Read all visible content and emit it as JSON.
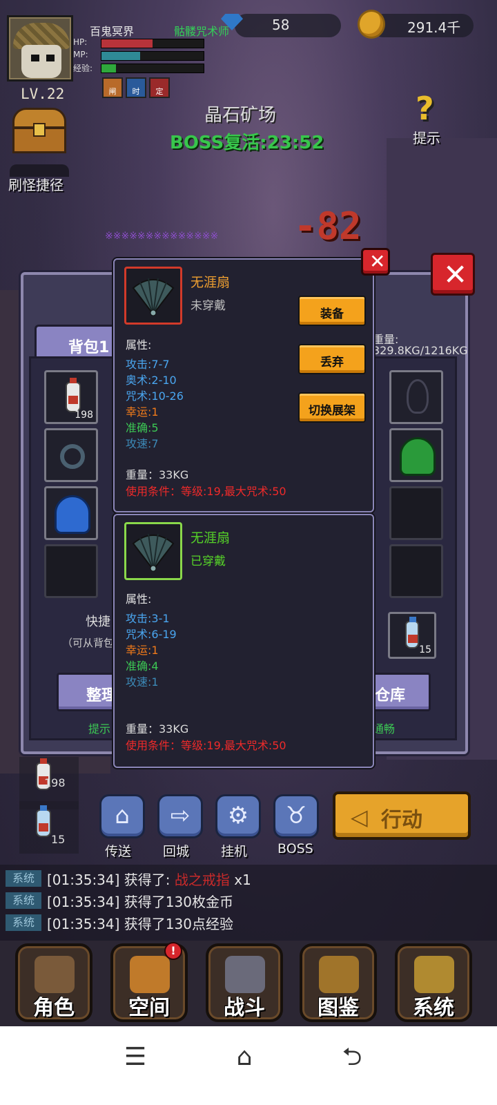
{
  "header": {
    "player_name": "百鬼冥界",
    "player_class": "骷髅咒术师",
    "stats": {
      "hp_label": "HP:",
      "hp_fraction": 0.5,
      "mp_label": "MP:",
      "mp_fraction": 0.38,
      "exp_label": "经验:",
      "exp_fraction": 0.14
    },
    "level": "LV.22",
    "buffs": [
      "闸",
      "时",
      "定"
    ],
    "gems": "58",
    "gold": "291.4千",
    "chest_shortcut_label": "刷怪捷径",
    "hint_label": "提示"
  },
  "map": {
    "name": "晶石矿场",
    "boss_timer": "BOSS复活:23:52"
  },
  "combat": {
    "damage": "-82",
    "scroll_text": "※※※※※※※※※※※※※※"
  },
  "bag": {
    "tab_label": "背包1",
    "weight_label": "重量:",
    "weight_value": "329.8KG/1216KG",
    "slot_counts": {
      "potion_red": "198",
      "potion_blue": "15"
    },
    "shortcut_title": "快捷",
    "shortcut_sub": "（可从背包",
    "btn_sort": "整理",
    "btn_storage": "仓库",
    "tip_left": "提示",
    "tip_right": "通畅"
  },
  "item_new": {
    "name": "无涯扇",
    "state": "未穿戴",
    "attr_title": "属性:",
    "attrs": [
      {
        "text": "攻击:7-7",
        "color": "#4aa6f0"
      },
      {
        "text": "奥术:2-10",
        "color": "#4aa6f0"
      },
      {
        "text": "咒术:10-26",
        "color": "#4aa6f0"
      },
      {
        "text": "幸运:1",
        "color": "#f07a1a"
      },
      {
        "text": "准确:5",
        "color": "#3cc854"
      },
      {
        "text": "攻速:7",
        "color": "#3c8ab8"
      }
    ],
    "weight": "重量：33KG",
    "requirement": "使用条件：等级:19,最大咒术:50",
    "buttons": {
      "equip": "装备",
      "discard": "丢弃",
      "switch_rack": "切换展架"
    }
  },
  "item_equipped": {
    "name": "无涯扇",
    "state": "已穿戴",
    "attr_title": "属性:",
    "attrs": [
      {
        "text": "攻击:3-1",
        "color": "#4aa6f0"
      },
      {
        "text": "咒术:6-19",
        "color": "#4aa6f0"
      },
      {
        "text": "幸运:1",
        "color": "#f07a1a"
      },
      {
        "text": "准确:4",
        "color": "#3cc854"
      },
      {
        "text": "攻速:1",
        "color": "#3c8ab8"
      }
    ],
    "weight": "重量：33KG",
    "requirement": "使用条件：等级:19,最大咒术:50"
  },
  "quick": {
    "red_count": "198",
    "blue_count": "15"
  },
  "actions": {
    "teleport": "传送",
    "return_city": "回城",
    "idle": "挂机",
    "boss": "BOSS",
    "go": "行动"
  },
  "log": {
    "tag": "系统",
    "rows": [
      {
        "time": "[01:35:34]",
        "prefix": "获得了:",
        "item": "战之戒指",
        "suffix": "x1"
      },
      {
        "time": "[01:35:34]",
        "prefix": "获得了130枚金币",
        "item": "",
        "suffix": ""
      },
      {
        "time": "[01:35:34]",
        "prefix": "获得了130点经验",
        "item": "",
        "suffix": ""
      }
    ]
  },
  "nav": {
    "character": "角色",
    "space": "空间",
    "space_badge": "!",
    "battle": "战斗",
    "codex": "图鉴",
    "system": "系统"
  },
  "sysbar": {
    "menu": "☰",
    "home": "⌂",
    "back": "⮌"
  },
  "colors": {
    "accent_orange": "#f4a21c",
    "close_red": "#d7262c",
    "panel_purple": "#8a84c2",
    "boss_green": "#38c64c",
    "name_new_orange": "#f0a030",
    "name_equipped_green": "#56d428"
  }
}
